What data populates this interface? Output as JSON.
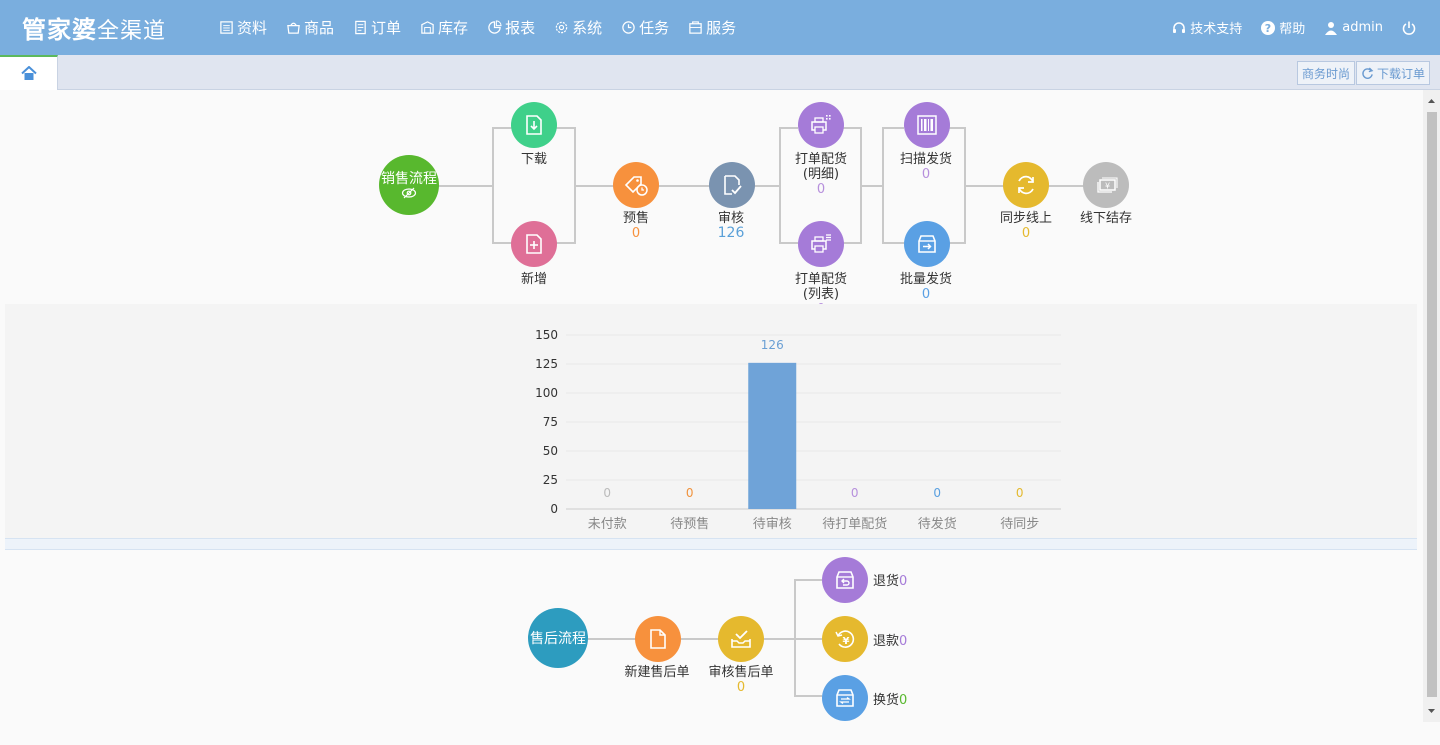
{
  "app": {
    "logo_main": "管家婆",
    "logo_sub": "全渠道"
  },
  "nav": [
    {
      "label": "资料",
      "icon": "list-icon"
    },
    {
      "label": "商品",
      "icon": "goods-icon"
    },
    {
      "label": "订单",
      "icon": "order-icon"
    },
    {
      "label": "库存",
      "icon": "stock-icon"
    },
    {
      "label": "报表",
      "icon": "report-icon"
    },
    {
      "label": "系统",
      "icon": "gear-icon"
    },
    {
      "label": "任务",
      "icon": "clock-icon"
    },
    {
      "label": "服务",
      "icon": "service-icon"
    }
  ],
  "right_nav": {
    "support": "技术支持",
    "help": "帮助",
    "user": "admin"
  },
  "tabs": {
    "btn1": "商务时尚",
    "btn2": "下载订单"
  },
  "sales": {
    "title": "销售流程",
    "download": "下载",
    "add": "新增",
    "presale": "预售",
    "presale_count": "0",
    "audit": "审核",
    "audit_count": "126",
    "print_detail": "打单配货",
    "print_detail_sub": "(明细)",
    "print_detail_count": "0",
    "print_list": "打单配货",
    "print_list_sub": "(列表)",
    "print_list_count": "0",
    "scan_ship": "扫描发货",
    "scan_ship_count": "0",
    "batch_ship": "批量发货",
    "batch_ship_count": "0",
    "sync": "同步线上",
    "sync_count": "0",
    "offline": "线下结存"
  },
  "chart_data": {
    "type": "bar",
    "categories": [
      "未付款",
      "待预售",
      "待审核",
      "待打单配货",
      "待发货",
      "待同步"
    ],
    "values": [
      0,
      0,
      126,
      0,
      0,
      0
    ],
    "label_colors": [
      "#bbbbbb",
      "#f0923c",
      "#6a9fd4",
      "#b68fdc",
      "#5aa0e0",
      "#e3b92e"
    ],
    "yticks": [
      0,
      25,
      50,
      75,
      100,
      125,
      150
    ],
    "ylim": [
      0,
      150
    ],
    "bar_color": "#6fa3d8"
  },
  "aftersale": {
    "title": "售后流程",
    "new": "新建售后单",
    "audit": "审核售后单",
    "audit_count": "0",
    "return_goods": "退货",
    "return_goods_count": "0",
    "refund": "退款",
    "refund_count": "0",
    "exchange": "换货",
    "exchange_count": "0"
  },
  "colors": {
    "header": "#7aaede",
    "green": "#58b82e",
    "teal": "#2d9cbf",
    "mint": "#3fd08a",
    "pink": "#df6f97",
    "orange": "#f7913d",
    "slate": "#7a93b0",
    "purple": "#a57bd8",
    "blue": "#5aa0e4",
    "yellow": "#e5b92e",
    "gray": "#bcbcbc"
  }
}
